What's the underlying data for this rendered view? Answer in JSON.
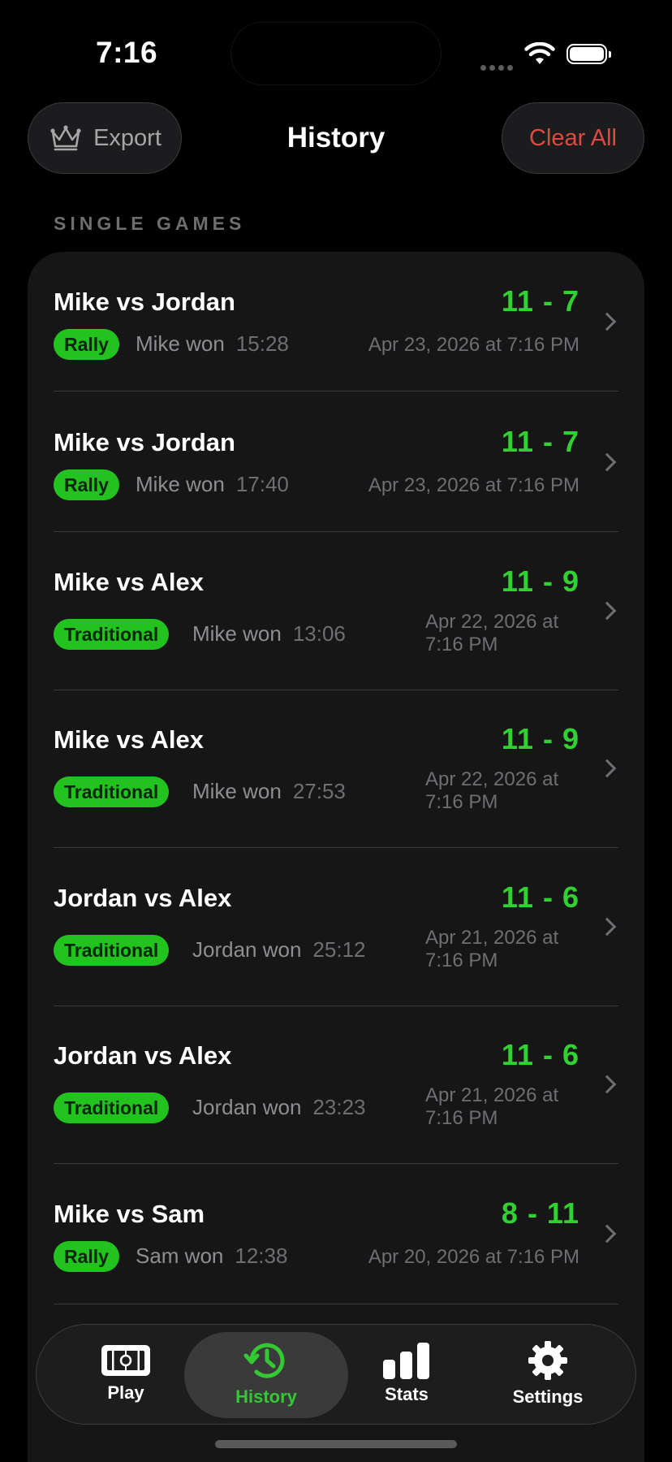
{
  "status_bar": {
    "time": "7:16"
  },
  "nav": {
    "export_label": "Export",
    "title": "History",
    "clear_label": "Clear All"
  },
  "section": {
    "header": "SINGLE GAMES"
  },
  "games": [
    {
      "title": "Mike vs Jordan",
      "score": "11 - 7",
      "mode": "Rally",
      "winner": "Mike won",
      "duration": "15:28",
      "date": "Apr 23, 2026 at 7:16 PM"
    },
    {
      "title": "Mike vs Jordan",
      "score": "11 - 7",
      "mode": "Rally",
      "winner": "Mike won",
      "duration": "17:40",
      "date": "Apr 23, 2026 at 7:16 PM"
    },
    {
      "title": "Mike vs Alex",
      "score": "11 - 9",
      "mode": "Traditional",
      "winner": "Mike won",
      "duration": "13:06",
      "date": "Apr 22, 2026 at 7:16 PM"
    },
    {
      "title": "Mike vs Alex",
      "score": "11 - 9",
      "mode": "Traditional",
      "winner": "Mike won",
      "duration": "27:53",
      "date": "Apr 22, 2026 at 7:16 PM"
    },
    {
      "title": "Jordan vs Alex",
      "score": "11 - 6",
      "mode": "Traditional",
      "winner": "Jordan won",
      "duration": "25:12",
      "date": "Apr 21, 2026 at 7:16 PM"
    },
    {
      "title": "Jordan vs Alex",
      "score": "11 - 6",
      "mode": "Traditional",
      "winner": "Jordan won",
      "duration": "23:23",
      "date": "Apr 21, 2026 at 7:16 PM"
    },
    {
      "title": "Mike vs Sam",
      "score": "8 - 11",
      "mode": "Rally",
      "winner": "Sam won",
      "duration": "12:38",
      "date": "Apr 20, 2026 at 7:16 PM"
    }
  ],
  "tabs": [
    {
      "label": "Play",
      "icon": "court-icon"
    },
    {
      "label": "History",
      "icon": "history-icon",
      "active": true
    },
    {
      "label": "Stats",
      "icon": "bar-chart-icon"
    },
    {
      "label": "Settings",
      "icon": "gear-icon"
    }
  ],
  "colors": {
    "accent": "#30d131",
    "badge": "#22c31f",
    "destructive": "#e0493f",
    "background": "#000000",
    "card": "#161616"
  }
}
